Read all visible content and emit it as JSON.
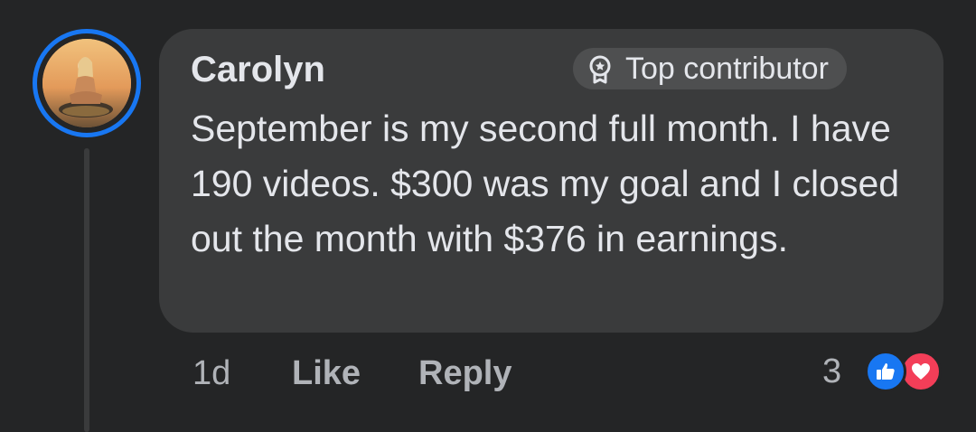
{
  "comment": {
    "author": "Carolyn",
    "badge": {
      "label": "Top contributor",
      "icon": "award-badge-icon"
    },
    "text": "September is my second full month. I have 190 videos. $300 was my goal and I closed out the month with $376 in earnings.",
    "timestamp": "1d",
    "actions": {
      "like_label": "Like",
      "reply_label": "Reply"
    },
    "reactions": {
      "count": "3",
      "types": [
        "like-icon",
        "love-icon"
      ]
    }
  },
  "colors": {
    "background": "#242526",
    "bubble": "#3a3b3c",
    "avatar_ring": "#1877f2",
    "like_reaction": "#1877f2",
    "love_reaction": "#f33e58"
  }
}
